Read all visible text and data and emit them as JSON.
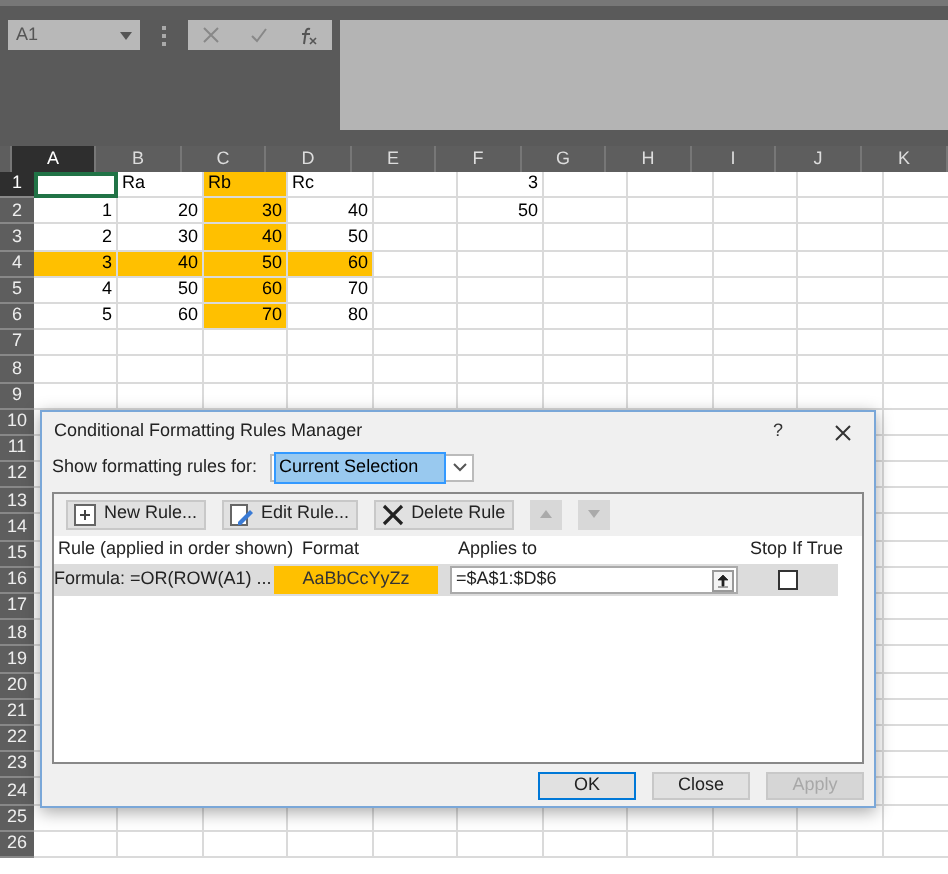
{
  "name_box": {
    "value": "A1"
  },
  "columns": [
    {
      "label": "A",
      "selected": true
    },
    {
      "label": "B",
      "selected": false
    },
    {
      "label": "C",
      "selected": false
    },
    {
      "label": "D",
      "selected": false
    },
    {
      "label": "E",
      "selected": false
    },
    {
      "label": "F",
      "selected": false
    },
    {
      "label": "G",
      "selected": false
    },
    {
      "label": "H",
      "selected": false
    },
    {
      "label": "I",
      "selected": false
    },
    {
      "label": "J",
      "selected": false
    },
    {
      "label": "K",
      "selected": false
    }
  ],
  "rows": [
    {
      "header": "1",
      "selected": true,
      "cells": [
        {
          "kind": "empty",
          "highlighted": false,
          "selected": true
        },
        {
          "kind": "text",
          "value": "Ra",
          "highlighted": false,
          "selected": false
        },
        {
          "kind": "text",
          "value": "Rb",
          "highlighted": true,
          "selected": false
        },
        {
          "kind": "text",
          "value": "Rc",
          "highlighted": false,
          "selected": false
        },
        {
          "kind": "empty",
          "highlighted": false,
          "selected": false
        },
        {
          "kind": "number",
          "value": "3",
          "highlighted": false,
          "selected": false
        }
      ]
    },
    {
      "header": "2",
      "selected": false,
      "cells": [
        {
          "kind": "number",
          "value": "1",
          "highlighted": false,
          "selected": false
        },
        {
          "kind": "number",
          "value": "20",
          "highlighted": false,
          "selected": false
        },
        {
          "kind": "number",
          "value": "30",
          "highlighted": true,
          "selected": false
        },
        {
          "kind": "number",
          "value": "40",
          "highlighted": false,
          "selected": false
        },
        {
          "kind": "empty",
          "highlighted": false,
          "selected": false
        },
        {
          "kind": "number",
          "value": "50",
          "highlighted": false,
          "selected": false
        }
      ]
    },
    {
      "header": "3",
      "selected": false,
      "cells": [
        {
          "kind": "number",
          "value": "2",
          "highlighted": false,
          "selected": false
        },
        {
          "kind": "number",
          "value": "30",
          "highlighted": false,
          "selected": false
        },
        {
          "kind": "number",
          "value": "40",
          "highlighted": true,
          "selected": false
        },
        {
          "kind": "number",
          "value": "50",
          "highlighted": false,
          "selected": false
        }
      ]
    },
    {
      "header": "4",
      "selected": false,
      "cells": [
        {
          "kind": "number",
          "value": "3",
          "highlighted": true,
          "selected": false
        },
        {
          "kind": "number",
          "value": "40",
          "highlighted": true,
          "selected": false
        },
        {
          "kind": "number",
          "value": "50",
          "highlighted": true,
          "selected": false
        },
        {
          "kind": "number",
          "value": "60",
          "highlighted": true,
          "selected": false
        }
      ]
    },
    {
      "header": "5",
      "selected": false,
      "cells": [
        {
          "kind": "number",
          "value": "4",
          "highlighted": false,
          "selected": false
        },
        {
          "kind": "number",
          "value": "50",
          "highlighted": false,
          "selected": false
        },
        {
          "kind": "number",
          "value": "60",
          "highlighted": true,
          "selected": false
        },
        {
          "kind": "number",
          "value": "70",
          "highlighted": false,
          "selected": false
        }
      ]
    },
    {
      "header": "6",
      "selected": false,
      "cells": [
        {
          "kind": "number",
          "value": "5",
          "highlighted": false,
          "selected": false
        },
        {
          "kind": "number",
          "value": "60",
          "highlighted": false,
          "selected": false
        },
        {
          "kind": "number",
          "value": "70",
          "highlighted": true,
          "selected": false
        },
        {
          "kind": "number",
          "value": "80",
          "highlighted": false,
          "selected": false
        }
      ]
    },
    {
      "header": "7",
      "selected": false
    },
    {
      "header": "8",
      "selected": false
    },
    {
      "header": "9",
      "selected": false
    },
    {
      "header": "10",
      "selected": false
    },
    {
      "header": "11",
      "selected": false
    },
    {
      "header": "12",
      "selected": false
    },
    {
      "header": "13",
      "selected": false
    },
    {
      "header": "14",
      "selected": false
    },
    {
      "header": "15",
      "selected": false
    },
    {
      "header": "16",
      "selected": false
    },
    {
      "header": "17",
      "selected": false
    },
    {
      "header": "18",
      "selected": false
    },
    {
      "header": "19",
      "selected": false
    },
    {
      "header": "20",
      "selected": false
    },
    {
      "header": "21",
      "selected": false
    },
    {
      "header": "22",
      "selected": false
    },
    {
      "header": "23",
      "selected": false
    },
    {
      "header": "24",
      "selected": false
    },
    {
      "header": "25",
      "selected": false
    },
    {
      "header": "26",
      "selected": false
    }
  ],
  "dialog": {
    "title": "Conditional Formatting Rules Manager",
    "help": "?",
    "show_rules_label": "Show formatting rules for:",
    "show_rules_value": "Current Selection",
    "toolbar": [
      {
        "kind": "new",
        "label": "New Rule...",
        "disabled": false
      },
      {
        "kind": "edit",
        "label": "Edit Rule...",
        "disabled": false
      },
      {
        "kind": "delete",
        "label": "Delete Rule",
        "disabled": false
      },
      {
        "kind": "up",
        "disabled": true
      },
      {
        "kind": "down",
        "disabled": true
      }
    ],
    "columns": [
      "Rule (applied in order shown)",
      "Format",
      "Applies to",
      "Stop If True"
    ],
    "rules": [
      {
        "rule": "Formula: =OR(ROW(A1) ...",
        "format_preview": "AaBbCcYyZz",
        "applies_to": "=$A$1:$D$6",
        "stop_if_true": false,
        "selected": true
      }
    ],
    "buttons": [
      {
        "label": "OK",
        "default": true,
        "disabled": false
      },
      {
        "label": "Close",
        "default": false,
        "disabled": false
      },
      {
        "label": "Apply",
        "default": false,
        "disabled": true
      }
    ]
  }
}
